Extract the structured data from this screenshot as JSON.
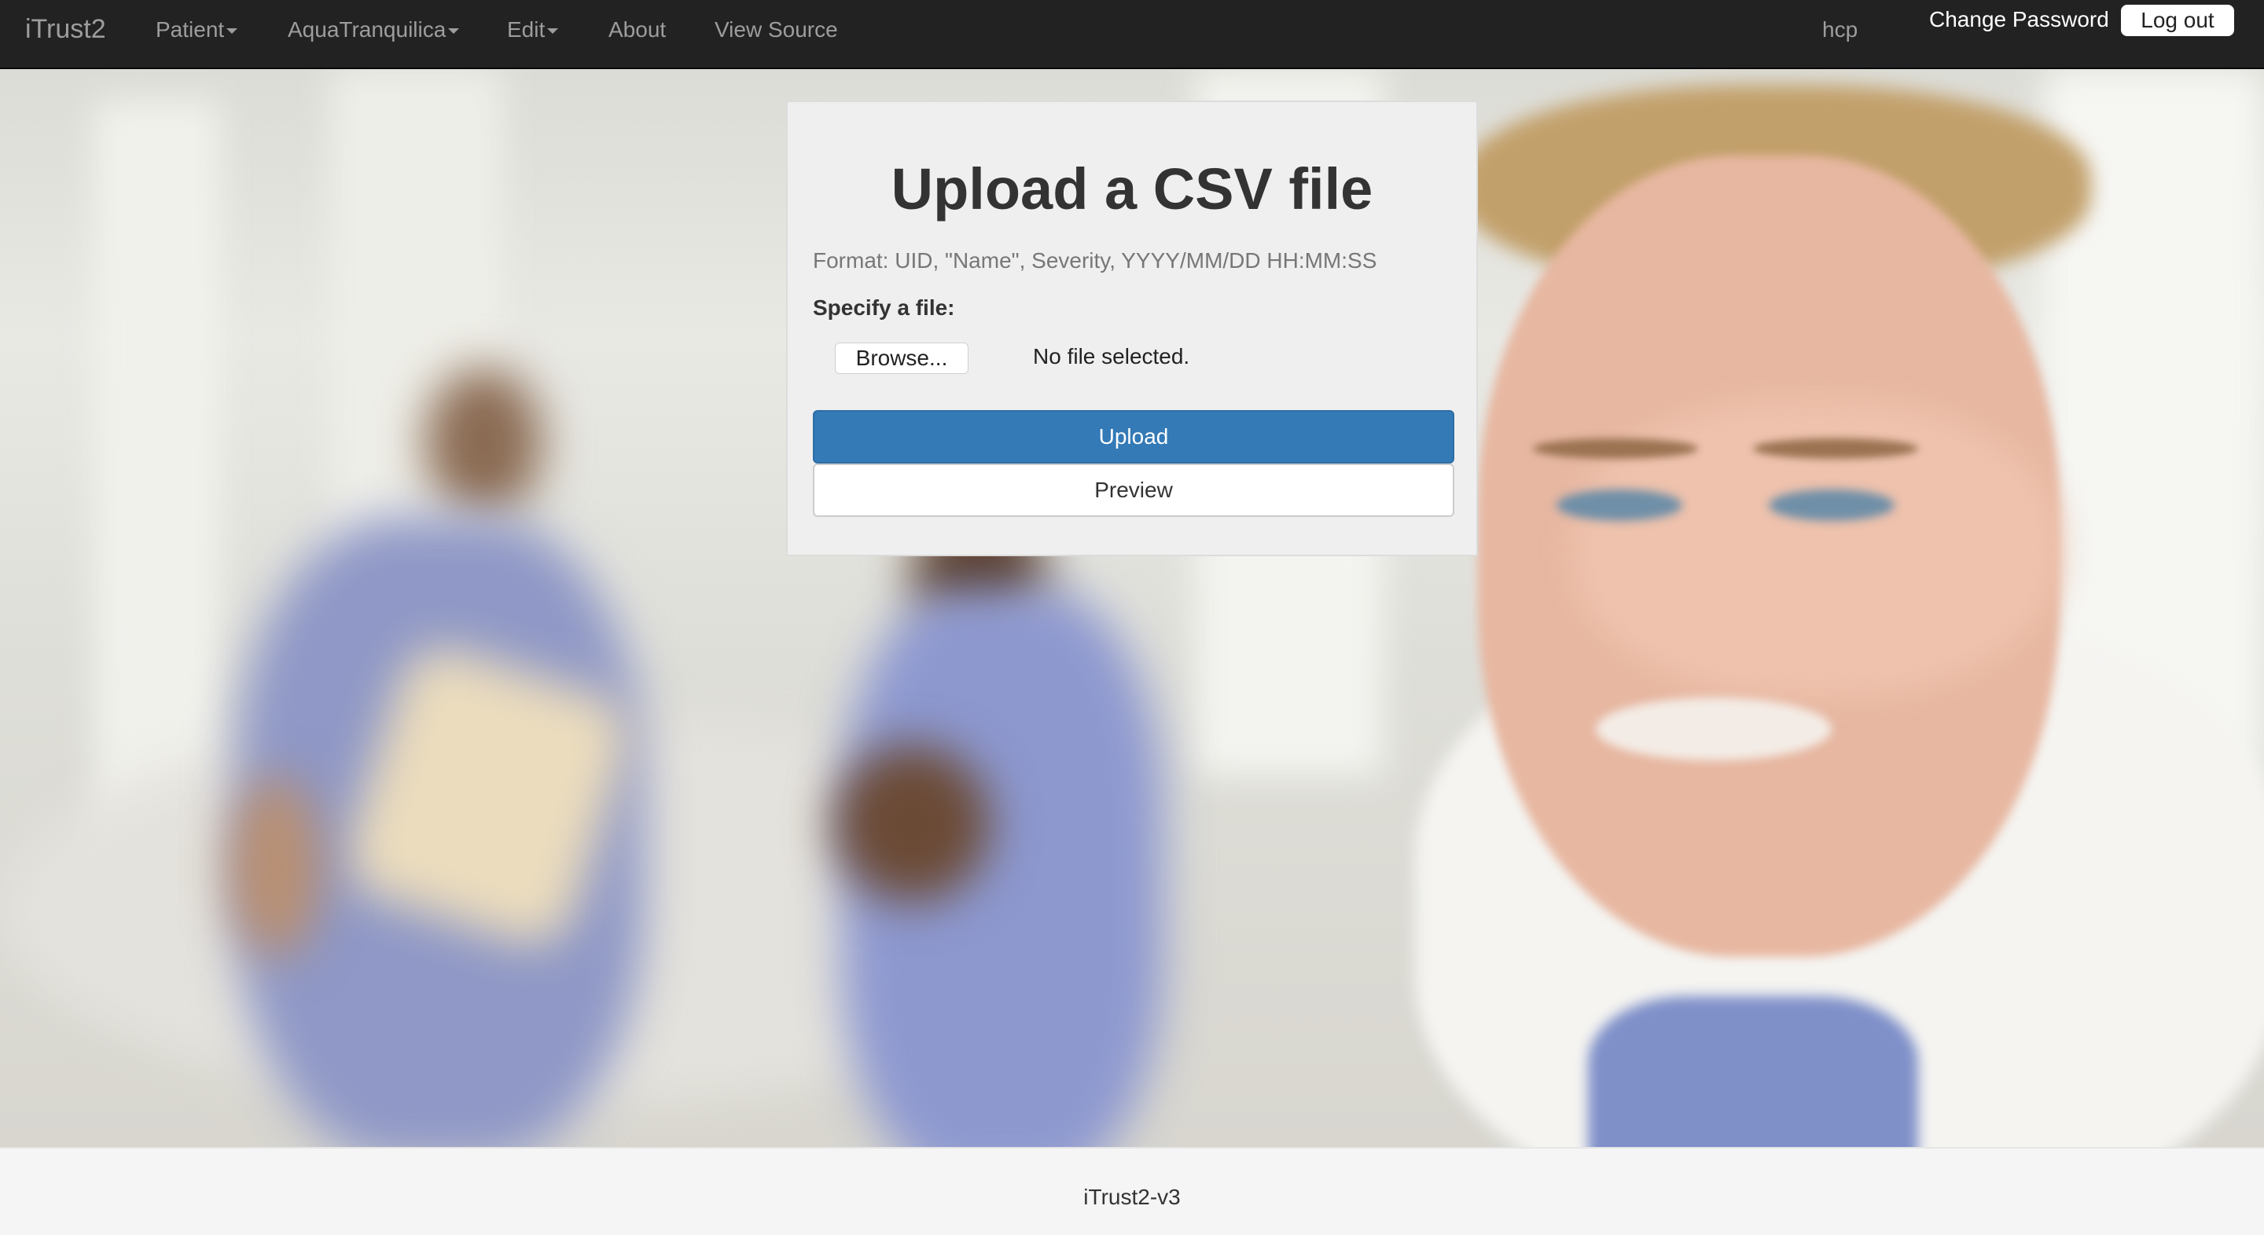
{
  "navbar": {
    "brand": "iTrust2",
    "menus": [
      {
        "label": "Patient"
      },
      {
        "label": "AquaTranquilica"
      },
      {
        "label": "Edit"
      }
    ],
    "links": [
      {
        "label": "About"
      },
      {
        "label": "View Source"
      }
    ],
    "username": "hcp",
    "change_password": "Change Password",
    "logout": "Log out"
  },
  "upload_card": {
    "title": "Upload a CSV file",
    "format_hint": "Format: UID, \"Name\", Severity, YYYY/MM/DD HH:MM:SS",
    "file_label": "Specify a file:",
    "browse_label": "Browse...",
    "file_status": "No file selected.",
    "upload_label": "Upload",
    "preview_label": "Preview"
  },
  "footer": {
    "text": "iTrust2-v3"
  },
  "colors": {
    "navbar_bg": "#222222",
    "primary": "#337ab7"
  }
}
